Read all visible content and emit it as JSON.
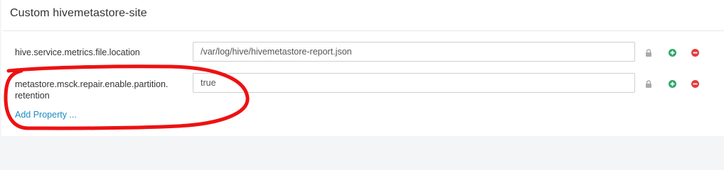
{
  "section": {
    "title": "Custom hivemetastore-site"
  },
  "properties": [
    {
      "name": "hive.service.metrics.file.location",
      "value": "/var/log/hive/hivemetastore-report.json"
    },
    {
      "name": "metastore.msck.repair.enable.partition.\nretention",
      "value": "true"
    }
  ],
  "add_property_label": "Add Property ...",
  "icons": {
    "lock": "lock-icon",
    "add": "plus-circle-icon",
    "remove": "minus-circle-icon"
  },
  "colors": {
    "add": "#2ea56a",
    "remove": "#e43b3b",
    "lock": "#aaaaaa",
    "link": "#1a8cc2",
    "annotation": "#ee1111"
  }
}
